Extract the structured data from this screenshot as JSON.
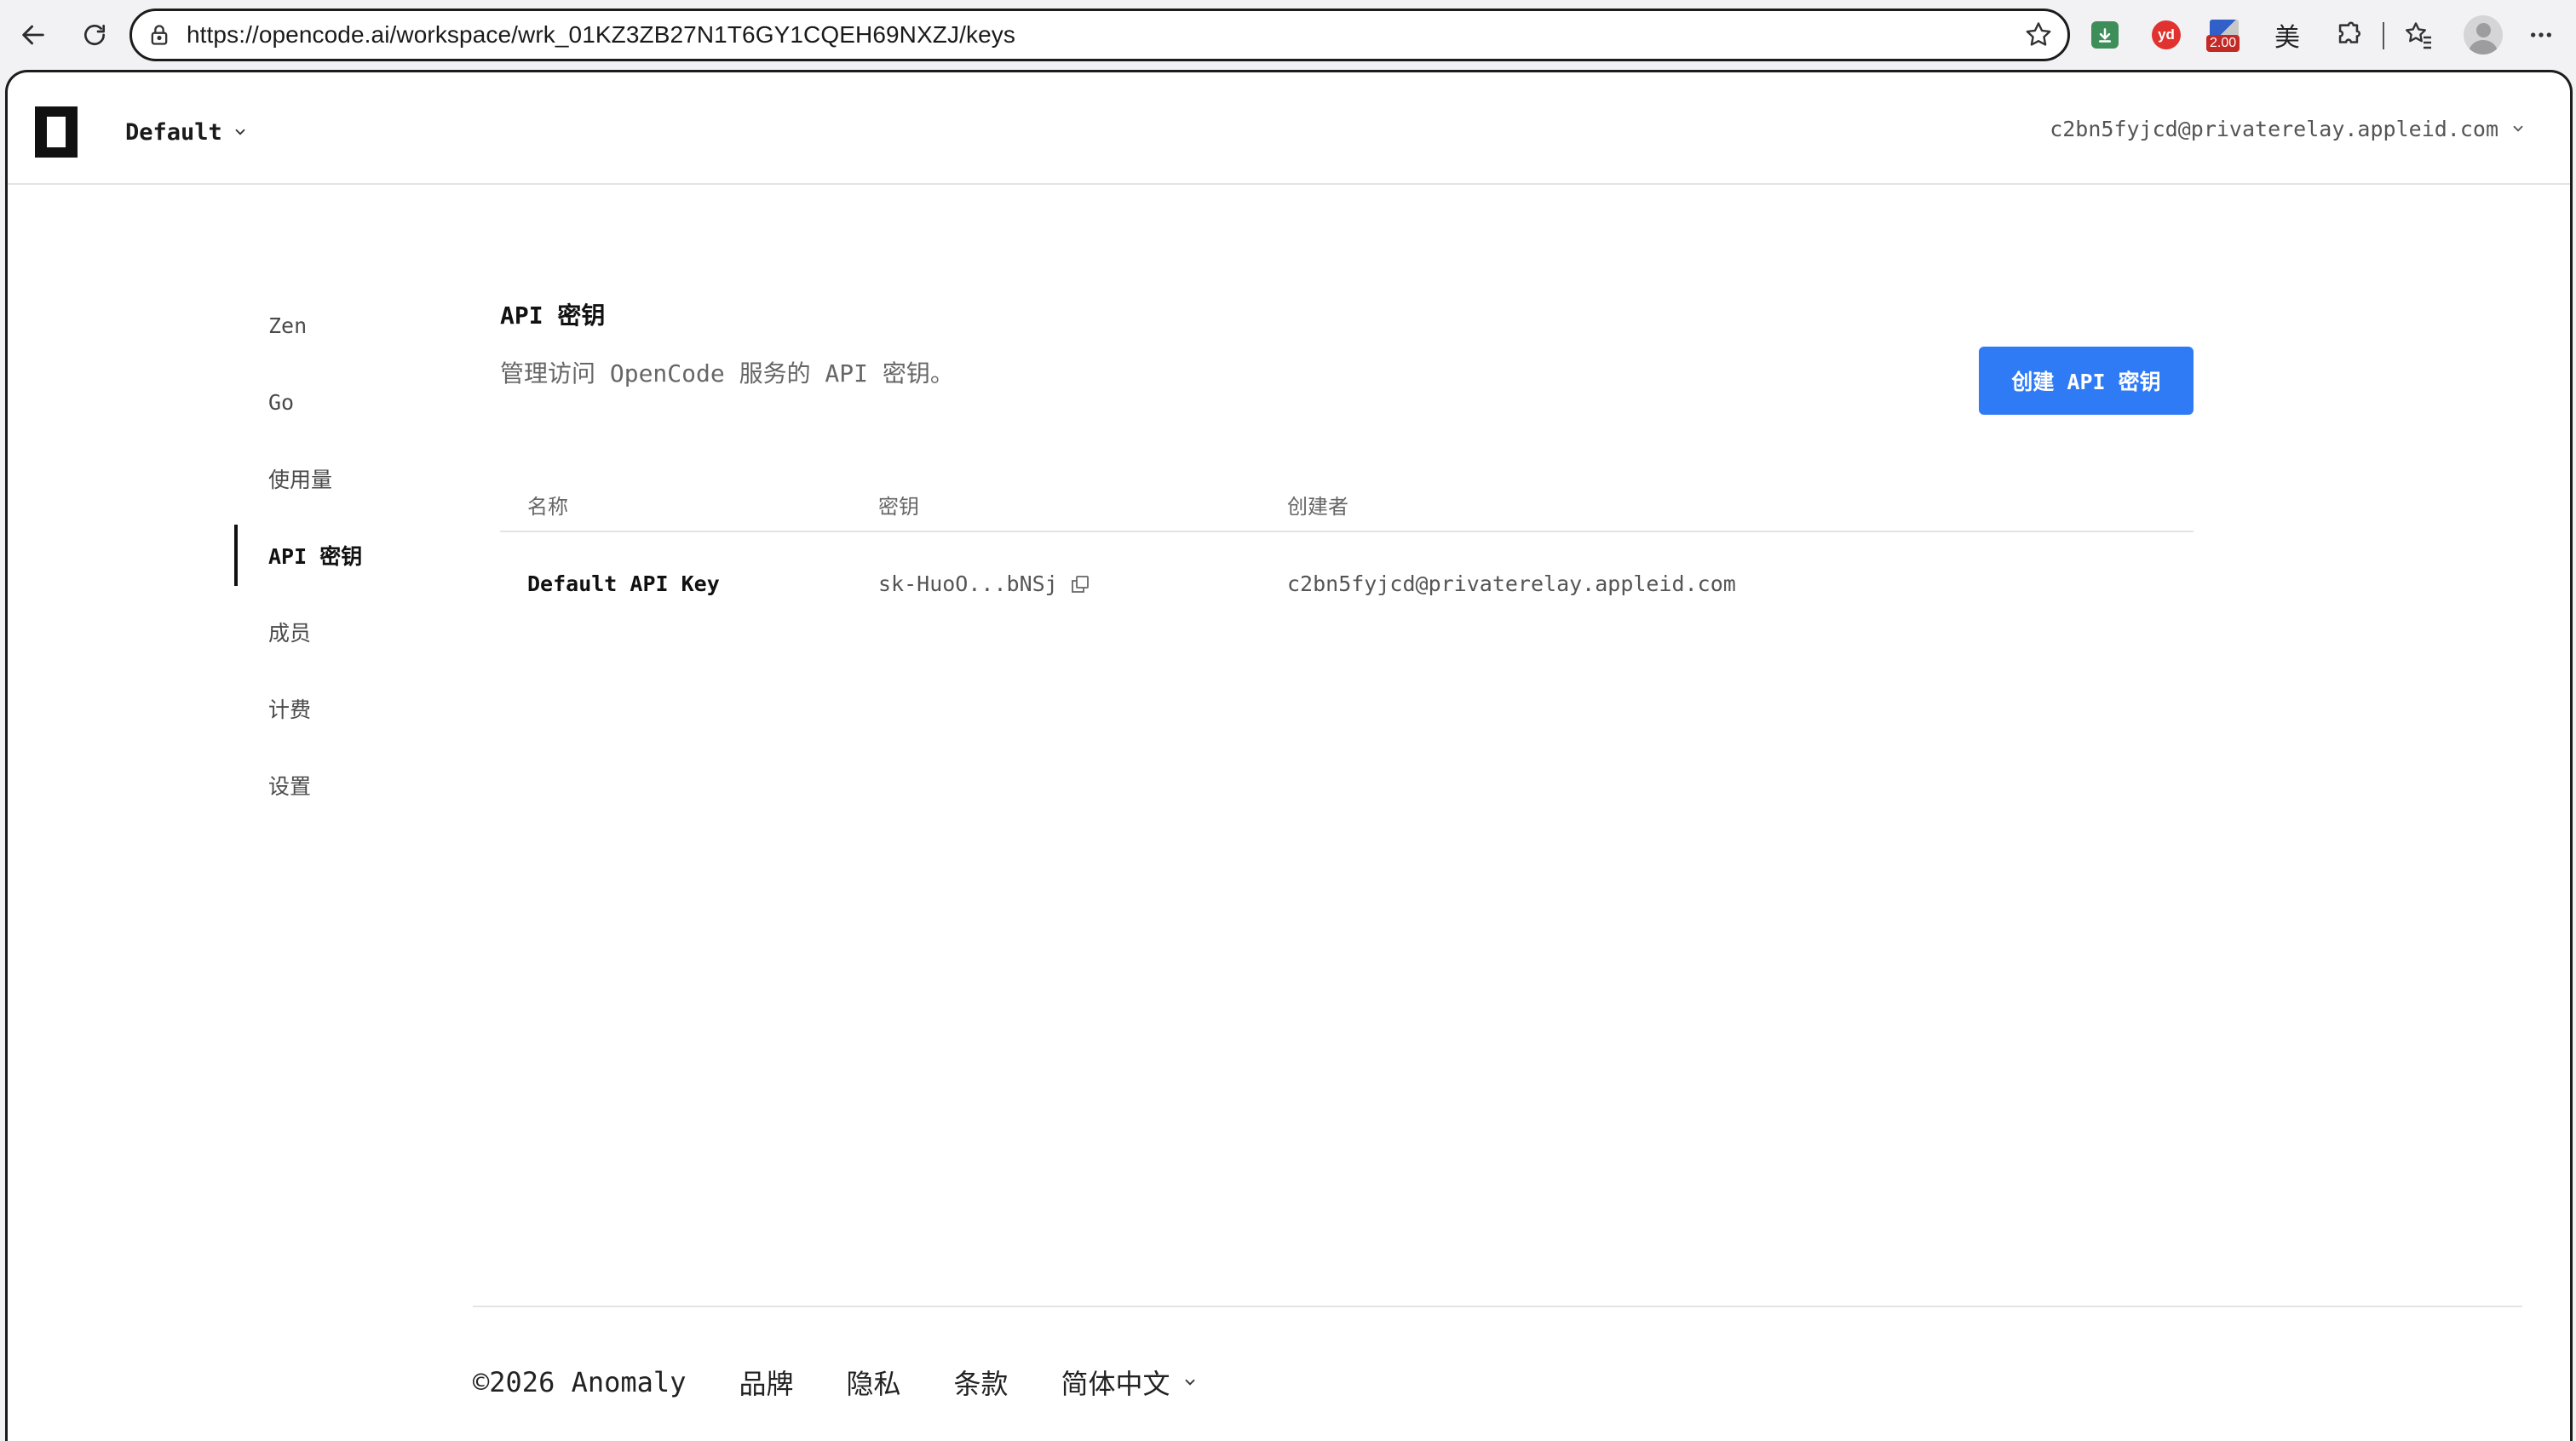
{
  "browser": {
    "url": "https://opencode.ai/workspace/wrk_01KZ3ZB27N1T6GY1CQEH69NXZJ/keys",
    "extensions": {
      "counter_badge": "2.00",
      "mei_label": "美",
      "yd_label": "yd"
    }
  },
  "header": {
    "workspace": "Default",
    "account": "c2bn5fyjcd@privaterelay.appleid.com"
  },
  "sidebar": {
    "items": [
      {
        "label": "Zen"
      },
      {
        "label": "Go"
      },
      {
        "label": "使用量"
      },
      {
        "label": "API 密钥",
        "active": true
      },
      {
        "label": "成员"
      },
      {
        "label": "计费"
      },
      {
        "label": "设置"
      }
    ]
  },
  "main": {
    "title": "API 密钥",
    "subtitle": "管理访问 OpenCode 服务的 API 密钥。",
    "create_button": "创建 API 密钥",
    "table": {
      "columns": [
        "名称",
        "密钥",
        "创建者"
      ],
      "rows": [
        {
          "name": "Default API Key",
          "key": "sk-HuoO...bNSj",
          "creator": "c2bn5fyjcd@privaterelay.appleid.com"
        }
      ]
    }
  },
  "footer": {
    "copyright": "©2026 Anomaly",
    "links": [
      "品牌",
      "隐私",
      "条款"
    ],
    "language": "简体中文"
  },
  "colors": {
    "accent": "#2f7bf6",
    "text": "#111111",
    "muted": "#666666",
    "border": "#e4e4e6"
  }
}
